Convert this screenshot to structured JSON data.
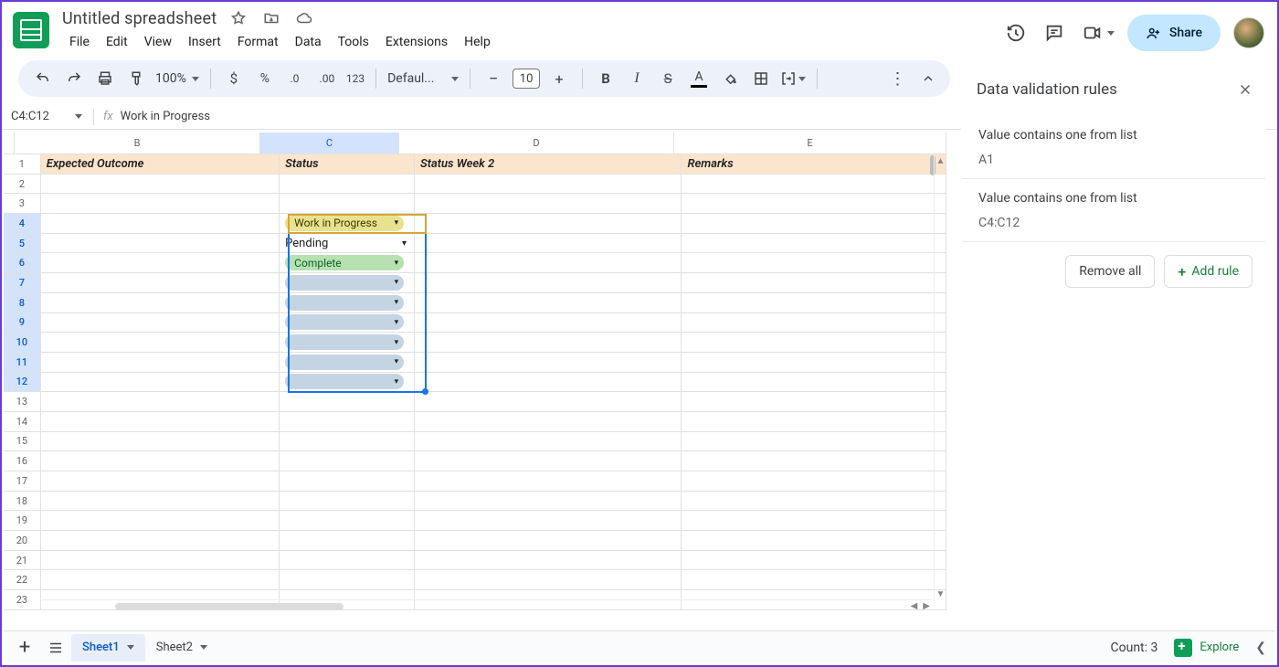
{
  "doc": {
    "title": "Untitled spreadsheet"
  },
  "menus": [
    "File",
    "Edit",
    "View",
    "Insert",
    "Format",
    "Data",
    "Tools",
    "Extensions",
    "Help"
  ],
  "share": {
    "label": "Share"
  },
  "toolbar": {
    "zoom": "100%",
    "font": "Defaul...",
    "font_size": "10",
    "number_format": "123"
  },
  "namebox": "C4:C12",
  "formula": "Work in Progress",
  "columns": [
    {
      "id": "B",
      "label": "B",
      "width": "col-B",
      "sel": false
    },
    {
      "id": "C",
      "label": "C",
      "width": "col-C",
      "sel": true
    },
    {
      "id": "D",
      "label": "D",
      "width": "col-D",
      "sel": false
    },
    {
      "id": "E",
      "label": "E",
      "width": "col-E",
      "sel": false
    }
  ],
  "headers": {
    "B": "Expected Outcome",
    "C": "Status",
    "D": "Status Week 2",
    "E": "Remarks"
  },
  "status_chips": [
    {
      "row": 4,
      "label": "Work in Progress",
      "class": "chip-wip"
    },
    {
      "row": 5,
      "label": "Pending",
      "class": "chip-pending"
    },
    {
      "row": 6,
      "label": "Complete",
      "class": "chip-complete"
    },
    {
      "row": 7,
      "label": "",
      "class": "chip-empty"
    },
    {
      "row": 8,
      "label": "",
      "class": "chip-empty"
    },
    {
      "row": 9,
      "label": "",
      "class": "chip-empty"
    },
    {
      "row": 10,
      "label": "",
      "class": "chip-empty"
    },
    {
      "row": 11,
      "label": "",
      "class": "chip-empty"
    },
    {
      "row": 12,
      "label": "",
      "class": "chip-empty"
    }
  ],
  "row_count": 23,
  "sidebar": {
    "title": "Data validation rules",
    "rules": [
      {
        "title": "Value contains one from list",
        "range": "A1"
      },
      {
        "title": "Value contains one from list",
        "range": "C4:C12"
      }
    ],
    "remove_all": "Remove all",
    "add_rule": "Add rule"
  },
  "sheets": [
    {
      "name": "Sheet1",
      "active": true
    },
    {
      "name": "Sheet2",
      "active": false
    }
  ],
  "bottom": {
    "count": "Count: 3",
    "explore": "Explore"
  }
}
